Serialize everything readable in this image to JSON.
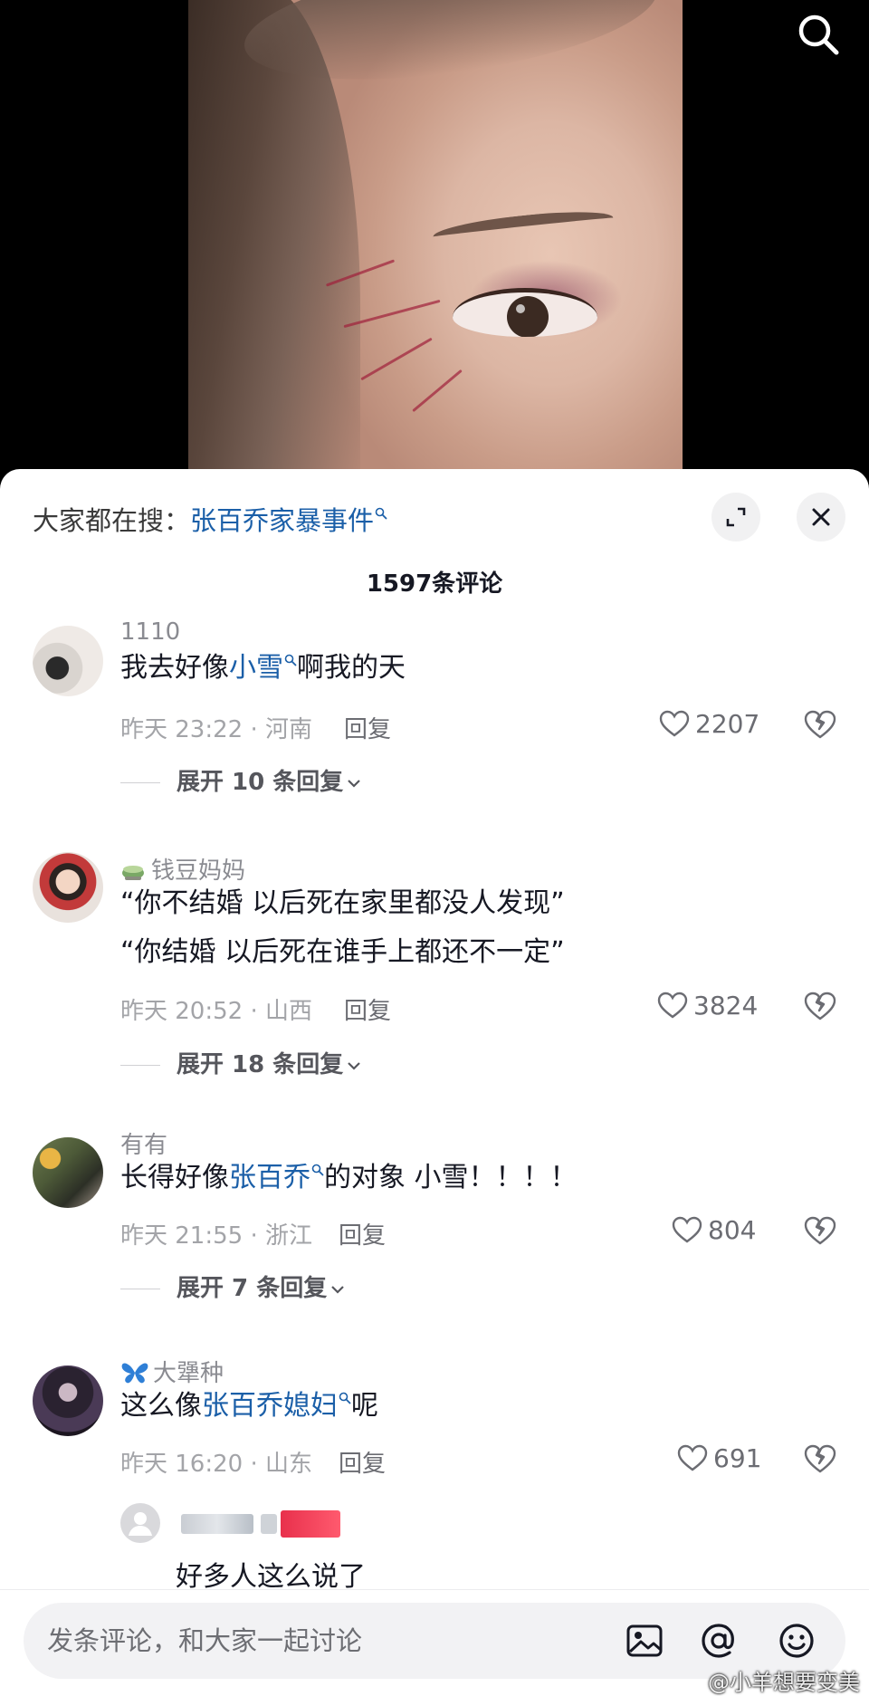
{
  "trending": {
    "prefix": "大家都在搜：",
    "keyword": "张百乔家暴事件"
  },
  "comment_count": "1597条评论",
  "comments": [
    {
      "username": "1110",
      "text_parts": [
        "我去好像",
        "小雪",
        "啊我的天"
      ],
      "time": "昨天 23:22",
      "location": "河南",
      "reply_label": "回复",
      "likes": "2207",
      "expand": "展开 10 条回复"
    },
    {
      "username": "钱豆妈妈",
      "text_lines": [
        "“你不结婚 以后死在家里都没人发现”",
        "“你结婚 以后死在谁手上都还不一定”"
      ],
      "time": "昨天 20:52",
      "location": "山西",
      "reply_label": "回复",
      "likes": "3824",
      "expand": "展开 18 条回复"
    },
    {
      "username": "有有",
      "text_parts": [
        "长得好像",
        "张百乔",
        "的对象 小雪！！！！"
      ],
      "time": "昨天 21:55",
      "location": "浙江",
      "reply_label": "回复",
      "likes": "804",
      "expand": "展开 7 条回复"
    },
    {
      "username": "大犟种",
      "text_parts": [
        "这么像",
        "张百乔媳妇",
        "呢"
      ],
      "time": "昨天 16:20",
      "location": "山东",
      "reply_label": "回复",
      "likes": "691",
      "sub_reply": "好多人这么说了"
    }
  ],
  "input": {
    "placeholder": "发条评论，和大家一起讨论"
  },
  "watermark": "@小羊想要变美",
  "colors": {
    "keyword": "#1b5fa8",
    "sheet_bg": "#ffffff",
    "input_bg": "#f2f2f4"
  },
  "icons": [
    "search-icon",
    "expand-icon",
    "close-icon",
    "heart-icon",
    "dislike-icon",
    "chevron-down-icon",
    "image-icon",
    "at-icon",
    "emoji-icon",
    "tea-icon",
    "butterfly-icon"
  ]
}
